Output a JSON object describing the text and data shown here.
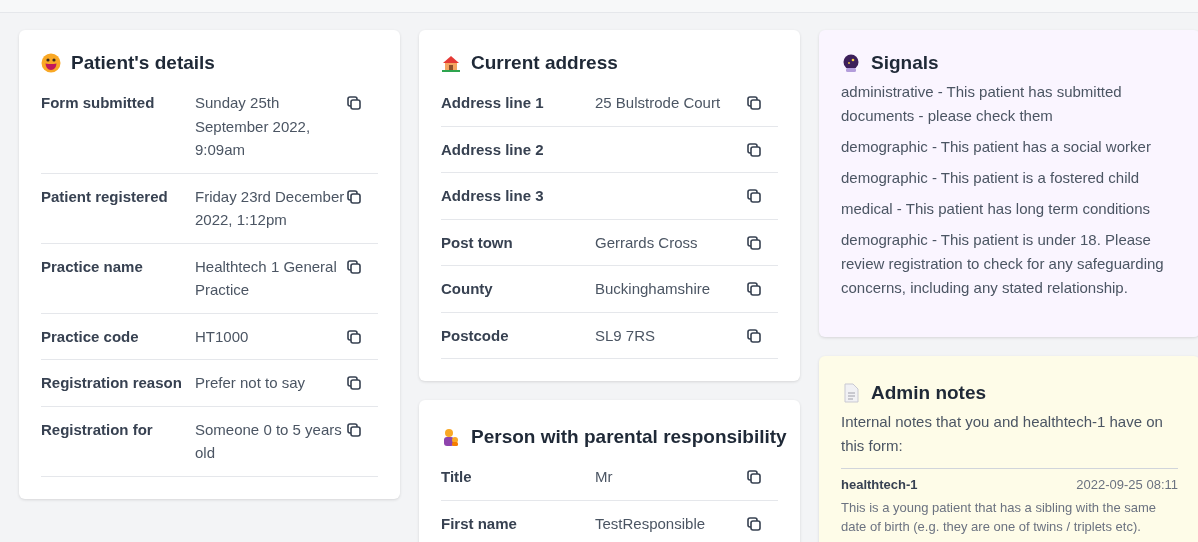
{
  "columns": [
    [
      {
        "kind": "patient",
        "title": "Patient's details",
        "rows": [
          {
            "label": "Form submitted",
            "value": "Sunday 25th September 2022, 9:09am"
          },
          {
            "label": "Patient registered",
            "value": "Friday 23rd December 2022, 1:12pm"
          },
          {
            "label": "Practice name",
            "value": "Healthtech 1 General Practice"
          },
          {
            "label": "Practice code",
            "value": "HT1000"
          },
          {
            "label": "Registration reason",
            "value": "Prefer not to say"
          },
          {
            "label": "Registration for",
            "value": "Someone 0 to 5 years old"
          }
        ]
      }
    ],
    [
      {
        "kind": "address",
        "title": "Current address",
        "rows": [
          {
            "label": "Address line 1",
            "value": "25 Bulstrode Court"
          },
          {
            "label": "Address line 2"
          },
          {
            "label": "Address line 3"
          },
          {
            "label": "Post town",
            "value": "Gerrards Cross"
          },
          {
            "label": "County",
            "value": "Buckinghamshire"
          },
          {
            "label": "Postcode",
            "value": "SL9 7RS"
          }
        ]
      },
      {
        "kind": "guardian",
        "title": "Person with parental responsibility",
        "rows": [
          {
            "label": "Title",
            "value": "Mr"
          },
          {
            "label": "First name",
            "value": "TestResponsible"
          }
        ]
      }
    ],
    [
      {
        "kind": "signals",
        "title": "Signals",
        "items": [
          "administrative - This patient has submitted documents - please check them",
          "demographic - This patient has a social worker",
          "demographic - This patient is a fostered child",
          "medical - This patient has long term conditions",
          "demographic - This patient is under 18. Please review registration to check for any safeguarding concerns, including any stated relationship."
        ]
      },
      {
        "kind": "notes",
        "title": "Admin notes",
        "intro": "Internal notes that you and healthtech-1 have on this form:",
        "notes": [
          {
            "author": "healthtech-1",
            "time": "2022-09-25 08:11",
            "text": "This is a young patient that has a sibling with the same date of birth (e.g. they are one of twins / triplets etc)."
          }
        ]
      }
    ]
  ]
}
